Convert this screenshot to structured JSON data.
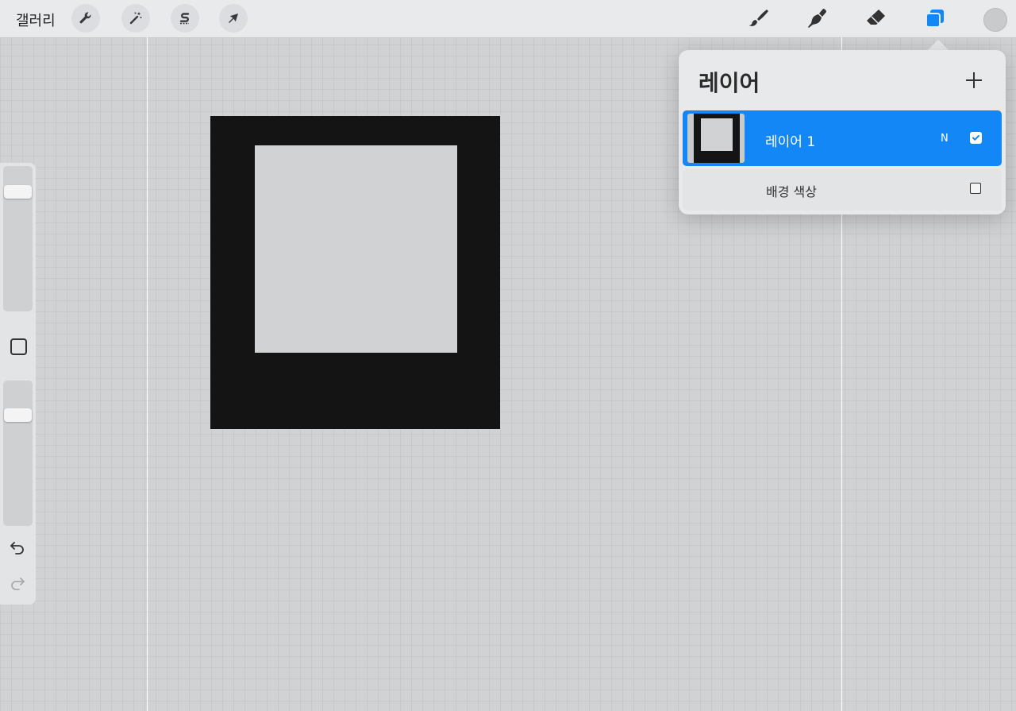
{
  "topbar": {
    "gallery_label": "갤러리",
    "left_tools": [
      "wrench-icon",
      "magic-wand-icon",
      "selection-s-icon",
      "transform-arrow-icon"
    ],
    "right_tools": [
      "brush-icon",
      "smudge-icon",
      "eraser-icon",
      "layers-icon"
    ],
    "active_tool": "layers-icon",
    "current_color": "#c9cacc"
  },
  "sidebar": {
    "brush_size_level": 0.85,
    "opacity_level": 0.79,
    "icons": [
      "modify-square-icon",
      "undo-icon",
      "redo-icon"
    ]
  },
  "layers_panel": {
    "title": "레이어",
    "add_icon": "plus-icon",
    "layers": [
      {
        "name": "레이어 1",
        "blend_mode": "N",
        "visible": true,
        "selected": true
      }
    ],
    "background": {
      "name": "배경 색상",
      "visible": false
    }
  },
  "colors": {
    "accent": "#1287f5",
    "canvas": "#d1d2d4",
    "ink": "#141414"
  }
}
